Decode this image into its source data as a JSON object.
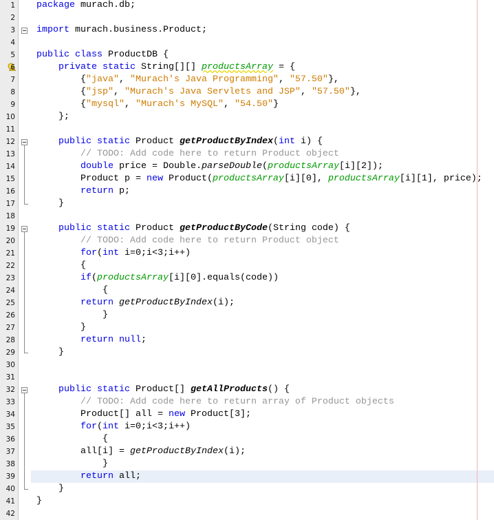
{
  "editor": {
    "current_line": 39,
    "warning_line": 6,
    "fold_starts": [
      3,
      12,
      19,
      32
    ],
    "fold_ranges": [
      [
        12,
        17
      ],
      [
        19,
        29
      ],
      [
        32,
        40
      ]
    ],
    "lines": [
      [
        [
          "k",
          "package"
        ],
        [
          "t",
          " murach.db;"
        ]
      ],
      [],
      [
        [
          "k",
          "import"
        ],
        [
          "t",
          " murach.business.Product;"
        ]
      ],
      [],
      [
        [
          "k",
          "public class"
        ],
        [
          "t",
          " ProductDB {"
        ]
      ],
      [
        [
          "t",
          "    "
        ],
        [
          "k",
          "private static"
        ],
        [
          "t",
          " String[][] "
        ],
        [
          "fw",
          "productsArray"
        ],
        [
          "t",
          " = {"
        ]
      ],
      [
        [
          "t",
          "        {"
        ],
        [
          "s",
          "\"java\""
        ],
        [
          "t",
          ", "
        ],
        [
          "s",
          "\"Murach's Java Programming\""
        ],
        [
          "t",
          ", "
        ],
        [
          "s",
          "\"57.50\""
        ],
        [
          "t",
          "},"
        ]
      ],
      [
        [
          "t",
          "        {"
        ],
        [
          "s",
          "\"jsp\""
        ],
        [
          "t",
          ", "
        ],
        [
          "s",
          "\"Murach's Java Servlets and JSP\""
        ],
        [
          "t",
          ", "
        ],
        [
          "s",
          "\"57.50\""
        ],
        [
          "t",
          "},"
        ]
      ],
      [
        [
          "t",
          "        {"
        ],
        [
          "s",
          "\"mysql\""
        ],
        [
          "t",
          ", "
        ],
        [
          "s",
          "\"Murach's MySQL\""
        ],
        [
          "t",
          ", "
        ],
        [
          "s",
          "\"54.50\""
        ],
        [
          "t",
          "}"
        ]
      ],
      [
        [
          "t",
          "    };"
        ]
      ],
      [],
      [
        [
          "t",
          "    "
        ],
        [
          "k",
          "public static"
        ],
        [
          "t",
          " Product "
        ],
        [
          "m",
          "getProductByIndex"
        ],
        [
          "t",
          "("
        ],
        [
          "k",
          "int"
        ],
        [
          "t",
          " i) {"
        ]
      ],
      [
        [
          "t",
          "        "
        ],
        [
          "c",
          "// TODO: Add code here to return Product object"
        ]
      ],
      [
        [
          "t",
          "        "
        ],
        [
          "k",
          "double"
        ],
        [
          "t",
          " price = Double."
        ],
        [
          "i",
          "parseDouble"
        ],
        [
          "t",
          "("
        ],
        [
          "f",
          "productsArray"
        ],
        [
          "t",
          "[i][2]);"
        ]
      ],
      [
        [
          "t",
          "        Product p = "
        ],
        [
          "k",
          "new"
        ],
        [
          "t",
          " Product("
        ],
        [
          "f",
          "productsArray"
        ],
        [
          "t",
          "[i][0], "
        ],
        [
          "f",
          "productsArray"
        ],
        [
          "t",
          "[i][1], price);"
        ]
      ],
      [
        [
          "t",
          "        "
        ],
        [
          "k",
          "return"
        ],
        [
          "t",
          " p;"
        ]
      ],
      [
        [
          "t",
          "    }"
        ]
      ],
      [],
      [
        [
          "t",
          "    "
        ],
        [
          "k",
          "public static"
        ],
        [
          "t",
          " Product "
        ],
        [
          "m",
          "getProductByCode"
        ],
        [
          "t",
          "(String code) {"
        ]
      ],
      [
        [
          "t",
          "        "
        ],
        [
          "c",
          "// TODO: Add code here to return Product object"
        ]
      ],
      [
        [
          "t",
          "        "
        ],
        [
          "k",
          "for"
        ],
        [
          "t",
          "("
        ],
        [
          "k",
          "int"
        ],
        [
          "t",
          " i=0;i<3;i++)"
        ]
      ],
      [
        [
          "t",
          "        {"
        ]
      ],
      [
        [
          "t",
          "        "
        ],
        [
          "k",
          "if"
        ],
        [
          "t",
          "("
        ],
        [
          "f",
          "productsArray"
        ],
        [
          "t",
          "[i][0].equals(code))"
        ]
      ],
      [
        [
          "t",
          "            {"
        ]
      ],
      [
        [
          "t",
          "        "
        ],
        [
          "k",
          "return"
        ],
        [
          "t",
          " "
        ],
        [
          "i",
          "getProductByIndex"
        ],
        [
          "t",
          "(i);"
        ]
      ],
      [
        [
          "t",
          "            }"
        ]
      ],
      [
        [
          "t",
          "        }"
        ]
      ],
      [
        [
          "t",
          "        "
        ],
        [
          "k",
          "return null"
        ],
        [
          "t",
          ";"
        ]
      ],
      [
        [
          "t",
          "    }"
        ]
      ],
      [],
      [],
      [
        [
          "t",
          "    "
        ],
        [
          "k",
          "public static"
        ],
        [
          "t",
          " Product[] "
        ],
        [
          "m",
          "getAllProducts"
        ],
        [
          "t",
          "() {"
        ]
      ],
      [
        [
          "t",
          "        "
        ],
        [
          "c",
          "// TODO: Add code here to return array of Product objects"
        ]
      ],
      [
        [
          "t",
          "        Product[] all = "
        ],
        [
          "k",
          "new"
        ],
        [
          "t",
          " Product[3];"
        ]
      ],
      [
        [
          "t",
          "        "
        ],
        [
          "k",
          "for"
        ],
        [
          "t",
          "("
        ],
        [
          "k",
          "int"
        ],
        [
          "t",
          " i=0;i<3;i++)"
        ]
      ],
      [
        [
          "t",
          "            {"
        ]
      ],
      [
        [
          "t",
          "        all[i] = "
        ],
        [
          "i",
          "getProductByIndex"
        ],
        [
          "t",
          "(i);"
        ]
      ],
      [
        [
          "t",
          "            }"
        ]
      ],
      [
        [
          "t",
          "        "
        ],
        [
          "k",
          "return"
        ],
        [
          "t",
          " all;"
        ]
      ],
      [
        [
          "t",
          "    }"
        ]
      ],
      [
        [
          "t",
          "}"
        ]
      ],
      []
    ]
  }
}
